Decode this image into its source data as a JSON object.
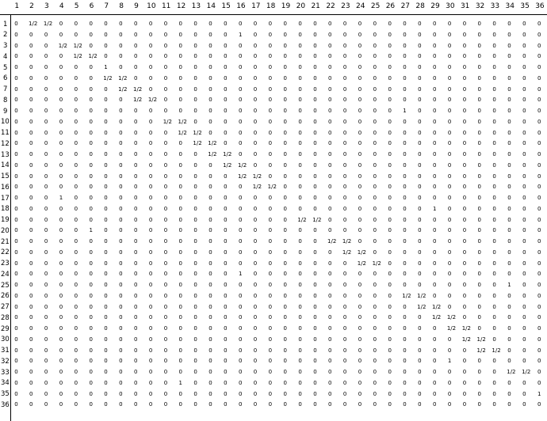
{
  "columns": [
    "1",
    "2",
    "3",
    "4",
    "5",
    "6",
    "7",
    "8",
    "9",
    "10",
    "11",
    "12",
    "13",
    "14",
    "15",
    "16",
    "17",
    "18",
    "19",
    "20",
    "21",
    "22",
    "23",
    "24",
    "25",
    "26",
    "27",
    "28",
    "29",
    "30",
    "31",
    "32",
    "33",
    "34",
    "35",
    "36"
  ],
  "row_labels": [
    "1",
    "2",
    "3",
    "4",
    "5",
    "6",
    "7",
    "8",
    "9",
    "10",
    "11",
    "12",
    "13",
    "14",
    "15",
    "16",
    "17",
    "18",
    "19",
    "20",
    "21",
    "22",
    "23",
    "24",
    "25",
    "26",
    "27",
    "28",
    "29",
    "30",
    "31",
    "32",
    "33",
    "34",
    "35",
    "36"
  ],
  "matrix": [
    [
      "0",
      "1/2",
      "1/2",
      "0",
      "0",
      "0",
      "0",
      "0",
      "0",
      "0",
      "0",
      "0",
      "0",
      "0",
      "0",
      "0",
      "0",
      "0",
      "0",
      "0",
      "0",
      "0",
      "0",
      "0",
      "0",
      "0",
      "0",
      "0",
      "0",
      "0",
      "0",
      "0",
      "0",
      "0",
      "0",
      "0"
    ],
    [
      "0",
      "0",
      "0",
      "0",
      "0",
      "0",
      "0",
      "0",
      "0",
      "0",
      "0",
      "0",
      "0",
      "0",
      "0",
      "1",
      "0",
      "0",
      "0",
      "0",
      "0",
      "0",
      "0",
      "0",
      "0",
      "0",
      "0",
      "0",
      "0",
      "0",
      "0",
      "0",
      "0",
      "0",
      "0",
      "0"
    ],
    [
      "0",
      "0",
      "0",
      "1/2",
      "1/2",
      "0",
      "0",
      "0",
      "0",
      "0",
      "0",
      "0",
      "0",
      "0",
      "0",
      "0",
      "0",
      "0",
      "0",
      "0",
      "0",
      "0",
      "0",
      "0",
      "0",
      "0",
      "0",
      "0",
      "0",
      "0",
      "0",
      "0",
      "0",
      "0",
      "0",
      "0"
    ],
    [
      "0",
      "0",
      "0",
      "0",
      "1/2",
      "1/2",
      "0",
      "0",
      "0",
      "0",
      "0",
      "0",
      "0",
      "0",
      "0",
      "0",
      "0",
      "0",
      "0",
      "0",
      "0",
      "0",
      "0",
      "0",
      "0",
      "0",
      "0",
      "0",
      "0",
      "0",
      "0",
      "0",
      "0",
      "0",
      "0",
      "0"
    ],
    [
      "0",
      "0",
      "0",
      "0",
      "0",
      "0",
      "1",
      "0",
      "0",
      "0",
      "0",
      "0",
      "0",
      "0",
      "0",
      "0",
      "0",
      "0",
      "0",
      "0",
      "0",
      "0",
      "0",
      "0",
      "0",
      "0",
      "0",
      "0",
      "0",
      "0",
      "0",
      "0",
      "0",
      "0",
      "0",
      "0"
    ],
    [
      "0",
      "0",
      "0",
      "0",
      "0",
      "0",
      "1/2",
      "1/2",
      "0",
      "0",
      "0",
      "0",
      "0",
      "0",
      "0",
      "0",
      "0",
      "0",
      "0",
      "0",
      "0",
      "0",
      "0",
      "0",
      "0",
      "0",
      "0",
      "0",
      "0",
      "0",
      "0",
      "0",
      "0",
      "0",
      "0",
      "0"
    ],
    [
      "0",
      "0",
      "0",
      "0",
      "0",
      "0",
      "0",
      "1/2",
      "1/2",
      "0",
      "0",
      "0",
      "0",
      "0",
      "0",
      "0",
      "0",
      "0",
      "0",
      "0",
      "0",
      "0",
      "0",
      "0",
      "0",
      "0",
      "0",
      "0",
      "0",
      "0",
      "0",
      "0",
      "0",
      "0",
      "0",
      "0"
    ],
    [
      "0",
      "0",
      "0",
      "0",
      "0",
      "0",
      "0",
      "0",
      "1/2",
      "1/2",
      "0",
      "0",
      "0",
      "0",
      "0",
      "0",
      "0",
      "0",
      "0",
      "0",
      "0",
      "0",
      "0",
      "0",
      "0",
      "0",
      "0",
      "0",
      "0",
      "0",
      "0",
      "0",
      "0",
      "0",
      "0",
      "0"
    ],
    [
      "0",
      "0",
      "0",
      "0",
      "0",
      "0",
      "0",
      "0",
      "0",
      "0",
      "0",
      "0",
      "0",
      "0",
      "0",
      "0",
      "0",
      "0",
      "0",
      "0",
      "0",
      "0",
      "0",
      "0",
      "0",
      "0",
      "1",
      "0",
      "0",
      "0",
      "0",
      "0",
      "0",
      "0",
      "0",
      "0"
    ],
    [
      "0",
      "0",
      "0",
      "0",
      "0",
      "0",
      "0",
      "0",
      "0",
      "0",
      "1/2",
      "1/2",
      "0",
      "0",
      "0",
      "0",
      "0",
      "0",
      "0",
      "0",
      "0",
      "0",
      "0",
      "0",
      "0",
      "0",
      "0",
      "0",
      "0",
      "0",
      "0",
      "0",
      "0",
      "0",
      "0",
      "0"
    ],
    [
      "0",
      "0",
      "0",
      "0",
      "0",
      "0",
      "0",
      "0",
      "0",
      "0",
      "0",
      "1/2",
      "1/2",
      "0",
      "0",
      "0",
      "0",
      "0",
      "0",
      "0",
      "0",
      "0",
      "0",
      "0",
      "0",
      "0",
      "0",
      "0",
      "0",
      "0",
      "0",
      "0",
      "0",
      "0",
      "0",
      "0"
    ],
    [
      "0",
      "0",
      "0",
      "0",
      "0",
      "0",
      "0",
      "0",
      "0",
      "0",
      "0",
      "0",
      "1/2",
      "1/2",
      "0",
      "0",
      "0",
      "0",
      "0",
      "0",
      "0",
      "0",
      "0",
      "0",
      "0",
      "0",
      "0",
      "0",
      "0",
      "0",
      "0",
      "0",
      "0",
      "0",
      "0",
      "0"
    ],
    [
      "0",
      "0",
      "0",
      "0",
      "0",
      "0",
      "0",
      "0",
      "0",
      "0",
      "0",
      "0",
      "0",
      "1/2",
      "1/2",
      "0",
      "0",
      "0",
      "0",
      "0",
      "0",
      "0",
      "0",
      "0",
      "0",
      "0",
      "0",
      "0",
      "0",
      "0",
      "0",
      "0",
      "0",
      "0",
      "0",
      "0"
    ],
    [
      "0",
      "0",
      "0",
      "0",
      "0",
      "0",
      "0",
      "0",
      "0",
      "0",
      "0",
      "0",
      "0",
      "0",
      "1/2",
      "1/2",
      "0",
      "0",
      "0",
      "0",
      "0",
      "0",
      "0",
      "0",
      "0",
      "0",
      "0",
      "0",
      "0",
      "0",
      "0",
      "0",
      "0",
      "0",
      "0",
      "0"
    ],
    [
      "0",
      "0",
      "0",
      "0",
      "0",
      "0",
      "0",
      "0",
      "0",
      "0",
      "0",
      "0",
      "0",
      "0",
      "0",
      "1/2",
      "1/2",
      "0",
      "0",
      "0",
      "0",
      "0",
      "0",
      "0",
      "0",
      "0",
      "0",
      "0",
      "0",
      "0",
      "0",
      "0",
      "0",
      "0",
      "0",
      "0"
    ],
    [
      "0",
      "0",
      "0",
      "0",
      "0",
      "0",
      "0",
      "0",
      "0",
      "0",
      "0",
      "0",
      "0",
      "0",
      "0",
      "0",
      "1/2",
      "1/2",
      "0",
      "0",
      "0",
      "0",
      "0",
      "0",
      "0",
      "0",
      "0",
      "0",
      "0",
      "0",
      "0",
      "0",
      "0",
      "0",
      "0",
      "0"
    ],
    [
      "0",
      "0",
      "0",
      "1",
      "0",
      "0",
      "0",
      "0",
      "0",
      "0",
      "0",
      "0",
      "0",
      "0",
      "0",
      "0",
      "0",
      "0",
      "0",
      "0",
      "0",
      "0",
      "0",
      "0",
      "0",
      "0",
      "0",
      "0",
      "0",
      "0",
      "0",
      "0",
      "0",
      "0",
      "0",
      "0"
    ],
    [
      "0",
      "0",
      "0",
      "0",
      "0",
      "0",
      "0",
      "0",
      "0",
      "0",
      "0",
      "0",
      "0",
      "0",
      "0",
      "0",
      "0",
      "0",
      "0",
      "0",
      "0",
      "0",
      "0",
      "0",
      "0",
      "0",
      "0",
      "0",
      "1",
      "0",
      "0",
      "0",
      "0",
      "0",
      "0",
      "0"
    ],
    [
      "0",
      "0",
      "0",
      "0",
      "0",
      "0",
      "0",
      "0",
      "0",
      "0",
      "0",
      "0",
      "0",
      "0",
      "0",
      "0",
      "0",
      "0",
      "0",
      "1/2",
      "1/2",
      "0",
      "0",
      "0",
      "0",
      "0",
      "0",
      "0",
      "0",
      "0",
      "0",
      "0",
      "0",
      "0",
      "0",
      "0"
    ],
    [
      "0",
      "0",
      "0",
      "0",
      "0",
      "1",
      "0",
      "0",
      "0",
      "0",
      "0",
      "0",
      "0",
      "0",
      "0",
      "0",
      "0",
      "0",
      "0",
      "0",
      "0",
      "0",
      "0",
      "0",
      "0",
      "0",
      "0",
      "0",
      "0",
      "0",
      "0",
      "0",
      "0",
      "0",
      "0",
      "0"
    ],
    [
      "0",
      "0",
      "0",
      "0",
      "0",
      "0",
      "0",
      "0",
      "0",
      "0",
      "0",
      "0",
      "0",
      "0",
      "0",
      "0",
      "0",
      "0",
      "0",
      "0",
      "0",
      "1/2",
      "1/2",
      "0",
      "0",
      "0",
      "0",
      "0",
      "0",
      "0",
      "0",
      "0",
      "0",
      "0",
      "0",
      "0"
    ],
    [
      "0",
      "0",
      "0",
      "0",
      "0",
      "0",
      "0",
      "0",
      "0",
      "0",
      "0",
      "0",
      "0",
      "0",
      "0",
      "0",
      "0",
      "0",
      "0",
      "0",
      "0",
      "0",
      "1/2",
      "1/2",
      "0",
      "0",
      "0",
      "0",
      "0",
      "0",
      "0",
      "0",
      "0",
      "0",
      "0",
      "0"
    ],
    [
      "0",
      "0",
      "0",
      "0",
      "0",
      "0",
      "0",
      "0",
      "0",
      "0",
      "0",
      "0",
      "0",
      "0",
      "0",
      "0",
      "0",
      "0",
      "0",
      "0",
      "0",
      "0",
      "0",
      "1/2",
      "1/2",
      "0",
      "0",
      "0",
      "0",
      "0",
      "0",
      "0",
      "0",
      "0",
      "0",
      "0"
    ],
    [
      "0",
      "0",
      "0",
      "0",
      "0",
      "0",
      "0",
      "0",
      "0",
      "0",
      "0",
      "0",
      "0",
      "0",
      "0",
      "1",
      "0",
      "0",
      "0",
      "0",
      "0",
      "0",
      "0",
      "0",
      "0",
      "0",
      "0",
      "0",
      "0",
      "0",
      "0",
      "0",
      "0",
      "0",
      "0",
      "0"
    ],
    [
      "0",
      "0",
      "0",
      "0",
      "0",
      "0",
      "0",
      "0",
      "0",
      "0",
      "0",
      "0",
      "0",
      "0",
      "0",
      "0",
      "0",
      "0",
      "0",
      "0",
      "0",
      "0",
      "0",
      "0",
      "0",
      "0",
      "0",
      "0",
      "0",
      "0",
      "0",
      "0",
      "0",
      "1",
      "0",
      "0"
    ],
    [
      "0",
      "0",
      "0",
      "0",
      "0",
      "0",
      "0",
      "0",
      "0",
      "0",
      "0",
      "0",
      "0",
      "0",
      "0",
      "0",
      "0",
      "0",
      "0",
      "0",
      "0",
      "0",
      "0",
      "0",
      "0",
      "0",
      "1/2",
      "1/2",
      "0",
      "0",
      "0",
      "0",
      "0",
      "0",
      "0",
      "0"
    ],
    [
      "0",
      "0",
      "0",
      "0",
      "0",
      "0",
      "0",
      "0",
      "0",
      "0",
      "0",
      "0",
      "0",
      "0",
      "0",
      "0",
      "0",
      "0",
      "0",
      "0",
      "0",
      "0",
      "0",
      "0",
      "0",
      "0",
      "0",
      "1/2",
      "1/2",
      "0",
      "0",
      "0",
      "0",
      "0",
      "0",
      "0"
    ],
    [
      "0",
      "0",
      "0",
      "0",
      "0",
      "0",
      "0",
      "0",
      "0",
      "0",
      "0",
      "0",
      "0",
      "0",
      "0",
      "0",
      "0",
      "0",
      "0",
      "0",
      "0",
      "0",
      "0",
      "0",
      "0",
      "0",
      "0",
      "0",
      "1/2",
      "1/2",
      "0",
      "0",
      "0",
      "0",
      "0",
      "0"
    ],
    [
      "0",
      "0",
      "0",
      "0",
      "0",
      "0",
      "0",
      "0",
      "0",
      "0",
      "0",
      "0",
      "0",
      "0",
      "0",
      "0",
      "0",
      "0",
      "0",
      "0",
      "0",
      "0",
      "0",
      "0",
      "0",
      "0",
      "0",
      "0",
      "0",
      "1/2",
      "1/2",
      "0",
      "0",
      "0",
      "0",
      "0"
    ],
    [
      "0",
      "0",
      "0",
      "0",
      "0",
      "0",
      "0",
      "0",
      "0",
      "0",
      "0",
      "0",
      "0",
      "0",
      "0",
      "0",
      "0",
      "0",
      "0",
      "0",
      "0",
      "0",
      "0",
      "0",
      "0",
      "0",
      "0",
      "0",
      "0",
      "0",
      "1/2",
      "1/2",
      "0",
      "0",
      "0",
      "0"
    ],
    [
      "0",
      "0",
      "0",
      "0",
      "0",
      "0",
      "0",
      "0",
      "0",
      "0",
      "0",
      "0",
      "0",
      "0",
      "0",
      "0",
      "0",
      "0",
      "0",
      "0",
      "0",
      "0",
      "0",
      "0",
      "0",
      "0",
      "0",
      "0",
      "0",
      "0",
      "0",
      "1/2",
      "1/2",
      "0",
      "0",
      "0"
    ],
    [
      "0",
      "0",
      "0",
      "0",
      "0",
      "0",
      "0",
      "0",
      "0",
      "0",
      "0",
      "0",
      "0",
      "0",
      "0",
      "0",
      "0",
      "0",
      "0",
      "0",
      "0",
      "0",
      "0",
      "0",
      "0",
      "0",
      "0",
      "0",
      "0",
      "1",
      "0",
      "0",
      "0",
      "0",
      "0",
      "0"
    ],
    [
      "0",
      "0",
      "0",
      "0",
      "0",
      "0",
      "0",
      "0",
      "0",
      "0",
      "0",
      "0",
      "0",
      "0",
      "0",
      "0",
      "0",
      "0",
      "0",
      "0",
      "0",
      "0",
      "0",
      "0",
      "0",
      "0",
      "0",
      "0",
      "0",
      "0",
      "0",
      "0",
      "0",
      "1/2",
      "1/2",
      "0"
    ],
    [
      "0",
      "0",
      "0",
      "0",
      "0",
      "0",
      "0",
      "0",
      "0",
      "0",
      "0",
      "1",
      "0",
      "0",
      "0",
      "0",
      "0",
      "0",
      "0",
      "0",
      "0",
      "0",
      "0",
      "0",
      "0",
      "0",
      "0",
      "0",
      "0",
      "0",
      "0",
      "0",
      "0",
      "0",
      "0",
      "0"
    ],
    [
      "0",
      "0",
      "0",
      "0",
      "0",
      "0",
      "0",
      "0",
      "0",
      "0",
      "0",
      "0",
      "0",
      "0",
      "0",
      "0",
      "0",
      "0",
      "0",
      "0",
      "0",
      "0",
      "0",
      "0",
      "0",
      "0",
      "0",
      "0",
      "0",
      "0",
      "0",
      "0",
      "0",
      "0",
      "0",
      "1"
    ],
    [
      "0",
      "0",
      "0",
      "0",
      "0",
      "0",
      "0",
      "0",
      "0",
      "0",
      "0",
      "0",
      "0",
      "0",
      "0",
      "0",
      "0",
      "0",
      "0",
      "0",
      "0",
      "0",
      "0",
      "0",
      "0",
      "0",
      "0",
      "0",
      "0",
      "0",
      "0",
      "0",
      "0",
      "0",
      "0",
      "0"
    ]
  ]
}
